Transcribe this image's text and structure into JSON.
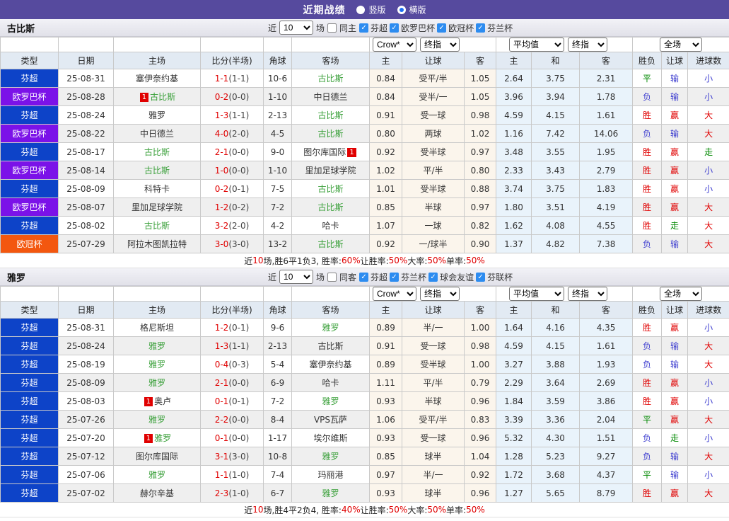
{
  "titlebar": {
    "title": "近期战绩",
    "vertical_label": "竖版",
    "horizontal_label": "横版"
  },
  "filters": {
    "near_label": "近",
    "count_value": "10",
    "matches_label": "场"
  },
  "dropdowns": {
    "company": "Crow*",
    "final": "终指",
    "average": "平均值",
    "final2": "终指",
    "scope": "全场"
  },
  "columns": [
    "类型",
    "日期",
    "主场",
    "比分(半场)",
    "角球",
    "客场",
    "主",
    "让球",
    "客",
    "主",
    "和",
    "客",
    "胜负",
    "让球",
    "进球数"
  ],
  "colors": {
    "topbar_purple": "#564a9e",
    "league_bg": {
      "芬超": "#0d43c8",
      "欧罗巴杯": "#7b12e8",
      "欧冠杯": "#f3570f"
    },
    "result_text": {
      "胜": "#e00000",
      "负": "#4040d0",
      "平": "#008800",
      "赢": "#e00000",
      "输": "#4040d0",
      "走": "#008800",
      "大": "#e00000",
      "小": "#4040d0"
    },
    "team_highlight": "#3aa03a",
    "score_red": "#e00000",
    "badge_bg": "#e00000",
    "checkbox_blue": "#2d8cf0",
    "beige_col": "#fbf5ec",
    "blue_col": "#e9f3fb",
    "stripe": "#efefef"
  },
  "sections": [
    {
      "team": "古比斯",
      "same_label": "同主",
      "league_filters": [
        "芬超",
        "欧罗巴杯",
        "欧冠杯",
        "芬兰杯"
      ],
      "rows": [
        {
          "league": "芬超",
          "date": "25-08-31",
          "home": {
            "name": "塞伊奈约基"
          },
          "score": "1-1",
          "half": "(1-1)",
          "corners": "10-6",
          "away": {
            "name": "古比斯",
            "hl": true
          },
          "odds": [
            "0.84",
            "受平/半",
            "1.05"
          ],
          "avg": [
            "2.64",
            "3.75",
            "2.31"
          ],
          "res": [
            "平",
            "输",
            "小"
          ]
        },
        {
          "league": "欧罗巴杯",
          "date": "25-08-28",
          "home": {
            "name": "古比斯",
            "hl": true,
            "badge": "1",
            "badge_pos": "before"
          },
          "score": "0-2",
          "half": "(0-0)",
          "corners": "1-10",
          "away": {
            "name": "中日德兰"
          },
          "odds": [
            "0.84",
            "受半/一",
            "1.05"
          ],
          "avg": [
            "3.96",
            "3.94",
            "1.78"
          ],
          "res": [
            "负",
            "输",
            "小"
          ]
        },
        {
          "league": "芬超",
          "date": "25-08-24",
          "home": {
            "name": "雅罗"
          },
          "score": "1-3",
          "half": "(1-1)",
          "corners": "2-13",
          "away": {
            "name": "古比斯",
            "hl": true
          },
          "odds": [
            "0.91",
            "受一球",
            "0.98"
          ],
          "avg": [
            "4.59",
            "4.15",
            "1.61"
          ],
          "res": [
            "胜",
            "赢",
            "大"
          ]
        },
        {
          "league": "欧罗巴杯",
          "date": "25-08-22",
          "home": {
            "name": "中日德兰"
          },
          "score": "4-0",
          "half": "(2-0)",
          "corners": "4-5",
          "away": {
            "name": "古比斯",
            "hl": true
          },
          "odds": [
            "0.80",
            "两球",
            "1.02"
          ],
          "avg": [
            "1.16",
            "7.42",
            "14.06"
          ],
          "res": [
            "负",
            "输",
            "大"
          ]
        },
        {
          "league": "芬超",
          "date": "25-08-17",
          "home": {
            "name": "古比斯",
            "hl": true
          },
          "score": "2-1",
          "half": "(0-0)",
          "corners": "9-0",
          "away": {
            "name": "图尔库国际",
            "badge": "1",
            "badge_pos": "after"
          },
          "odds": [
            "0.92",
            "受半球",
            "0.97"
          ],
          "avg": [
            "3.48",
            "3.55",
            "1.95"
          ],
          "res": [
            "胜",
            "赢",
            "走"
          ]
        },
        {
          "league": "欧罗巴杯",
          "date": "25-08-14",
          "home": {
            "name": "古比斯",
            "hl": true
          },
          "score": "1-0",
          "half": "(0-0)",
          "corners": "1-10",
          "away": {
            "name": "里加足球学院"
          },
          "odds": [
            "1.02",
            "平/半",
            "0.80"
          ],
          "avg": [
            "2.33",
            "3.43",
            "2.79"
          ],
          "res": [
            "胜",
            "赢",
            "小"
          ]
        },
        {
          "league": "芬超",
          "date": "25-08-09",
          "home": {
            "name": "科特卡"
          },
          "score": "0-2",
          "half": "(0-1)",
          "corners": "7-5",
          "away": {
            "name": "古比斯",
            "hl": true
          },
          "odds": [
            "1.01",
            "受半球",
            "0.88"
          ],
          "avg": [
            "3.74",
            "3.75",
            "1.83"
          ],
          "res": [
            "胜",
            "赢",
            "小"
          ]
        },
        {
          "league": "欧罗巴杯",
          "date": "25-08-07",
          "home": {
            "name": "里加足球学院"
          },
          "score": "1-2",
          "half": "(0-2)",
          "corners": "7-2",
          "away": {
            "name": "古比斯",
            "hl": true
          },
          "odds": [
            "0.85",
            "半球",
            "0.97"
          ],
          "avg": [
            "1.80",
            "3.51",
            "4.19"
          ],
          "res": [
            "胜",
            "赢",
            "大"
          ]
        },
        {
          "league": "芬超",
          "date": "25-08-02",
          "home": {
            "name": "古比斯",
            "hl": true
          },
          "score": "3-2",
          "half": "(2-0)",
          "corners": "4-2",
          "away": {
            "name": "哈卡"
          },
          "odds": [
            "1.07",
            "一球",
            "0.82"
          ],
          "avg": [
            "1.62",
            "4.08",
            "4.55"
          ],
          "res": [
            "胜",
            "走",
            "大"
          ]
        },
        {
          "league": "欧冠杯",
          "date": "25-07-29",
          "home": {
            "name": "阿拉木图凯拉特"
          },
          "score": "3-0",
          "half": "(3-0)",
          "corners": "13-2",
          "away": {
            "name": "古比斯",
            "hl": true
          },
          "odds": [
            "0.92",
            "一/球半",
            "0.90"
          ],
          "avg": [
            "1.37",
            "4.82",
            "7.38"
          ],
          "res": [
            "负",
            "输",
            "大"
          ]
        }
      ],
      "summary": [
        {
          "t": "近"
        },
        {
          "t": "10",
          "red": true
        },
        {
          "t": "场,胜6平1负3, 胜率:"
        },
        {
          "t": "60%",
          "red": true
        },
        {
          "t": " 让胜率:"
        },
        {
          "t": "50%",
          "red": true
        },
        {
          "t": " 大率:"
        },
        {
          "t": "50%",
          "red": true
        },
        {
          "t": " 单率:"
        },
        {
          "t": "50%",
          "red": true
        }
      ]
    },
    {
      "team": "雅罗",
      "same_label": "同客",
      "league_filters": [
        "芬超",
        "芬兰杯",
        "球会友谊",
        "芬联杯"
      ],
      "rows": [
        {
          "league": "芬超",
          "date": "25-08-31",
          "home": {
            "name": "格尼斯坦"
          },
          "score": "1-2",
          "half": "(0-1)",
          "corners": "9-6",
          "away": {
            "name": "雅罗",
            "hl": true
          },
          "odds": [
            "0.89",
            "半/一",
            "1.00"
          ],
          "avg": [
            "1.64",
            "4.16",
            "4.35"
          ],
          "res": [
            "胜",
            "赢",
            "小"
          ]
        },
        {
          "league": "芬超",
          "date": "25-08-24",
          "home": {
            "name": "雅罗",
            "hl": true
          },
          "score": "1-3",
          "half": "(1-1)",
          "corners": "2-13",
          "away": {
            "name": "古比斯"
          },
          "odds": [
            "0.91",
            "受一球",
            "0.98"
          ],
          "avg": [
            "4.59",
            "4.15",
            "1.61"
          ],
          "res": [
            "负",
            "输",
            "大"
          ]
        },
        {
          "league": "芬超",
          "date": "25-08-19",
          "home": {
            "name": "雅罗",
            "hl": true
          },
          "score": "0-4",
          "half": "(0-3)",
          "corners": "5-4",
          "away": {
            "name": "塞伊奈约基"
          },
          "odds": [
            "0.89",
            "受半球",
            "1.00"
          ],
          "avg": [
            "3.27",
            "3.88",
            "1.93"
          ],
          "res": [
            "负",
            "输",
            "大"
          ]
        },
        {
          "league": "芬超",
          "date": "25-08-09",
          "home": {
            "name": "雅罗",
            "hl": true
          },
          "score": "2-1",
          "half": "(0-0)",
          "corners": "6-9",
          "away": {
            "name": "哈卡"
          },
          "odds": [
            "1.11",
            "平/半",
            "0.79"
          ],
          "avg": [
            "2.29",
            "3.64",
            "2.69"
          ],
          "res": [
            "胜",
            "赢",
            "小"
          ]
        },
        {
          "league": "芬超",
          "date": "25-08-03",
          "home": {
            "name": "奥卢",
            "badge": "1",
            "badge_pos": "before"
          },
          "score": "0-1",
          "half": "(0-1)",
          "corners": "7-2",
          "away": {
            "name": "雅罗",
            "hl": true
          },
          "odds": [
            "0.93",
            "半球",
            "0.96"
          ],
          "avg": [
            "1.84",
            "3.59",
            "3.86"
          ],
          "res": [
            "胜",
            "赢",
            "小"
          ]
        },
        {
          "league": "芬超",
          "date": "25-07-26",
          "home": {
            "name": "雅罗",
            "hl": true
          },
          "score": "2-2",
          "half": "(0-0)",
          "corners": "8-4",
          "away": {
            "name": "VPS瓦萨"
          },
          "odds": [
            "1.06",
            "受平/半",
            "0.83"
          ],
          "avg": [
            "3.39",
            "3.36",
            "2.04"
          ],
          "res": [
            "平",
            "赢",
            "大"
          ]
        },
        {
          "league": "芬超",
          "date": "25-07-20",
          "home": {
            "name": "雅罗",
            "hl": true,
            "badge": "1",
            "badge_pos": "before"
          },
          "score": "0-1",
          "half": "(0-0)",
          "corners": "1-17",
          "away": {
            "name": "埃尔维斯"
          },
          "odds": [
            "0.93",
            "受一球",
            "0.96"
          ],
          "avg": [
            "5.32",
            "4.30",
            "1.51"
          ],
          "res": [
            "负",
            "走",
            "小"
          ]
        },
        {
          "league": "芬超",
          "date": "25-07-12",
          "home": {
            "name": "图尔库国际"
          },
          "score": "3-1",
          "half": "(3-0)",
          "corners": "10-8",
          "away": {
            "name": "雅罗",
            "hl": true
          },
          "odds": [
            "0.85",
            "球半",
            "1.04"
          ],
          "avg": [
            "1.28",
            "5.23",
            "9.27"
          ],
          "res": [
            "负",
            "输",
            "大"
          ]
        },
        {
          "league": "芬超",
          "date": "25-07-06",
          "home": {
            "name": "雅罗",
            "hl": true
          },
          "score": "1-1",
          "half": "(1-0)",
          "corners": "7-4",
          "away": {
            "name": "玛丽港"
          },
          "odds": [
            "0.97",
            "半/一",
            "0.92"
          ],
          "avg": [
            "1.72",
            "3.68",
            "4.37"
          ],
          "res": [
            "平",
            "输",
            "小"
          ]
        },
        {
          "league": "芬超",
          "date": "25-07-02",
          "home": {
            "name": "赫尔辛基"
          },
          "score": "2-3",
          "half": "(1-0)",
          "corners": "6-7",
          "away": {
            "name": "雅罗",
            "hl": true
          },
          "odds": [
            "0.93",
            "球半",
            "0.96"
          ],
          "avg": [
            "1.27",
            "5.65",
            "8.79"
          ],
          "res": [
            "胜",
            "赢",
            "大"
          ]
        }
      ],
      "summary": [
        {
          "t": "近"
        },
        {
          "t": "10",
          "red": true
        },
        {
          "t": "场,胜4平2负4, 胜率:"
        },
        {
          "t": "40%",
          "red": true
        },
        {
          "t": " 让胜率:"
        },
        {
          "t": "50%",
          "red": true
        },
        {
          "t": " 大率:"
        },
        {
          "t": "50%",
          "red": true
        },
        {
          "t": " 单率:"
        },
        {
          "t": "50%",
          "red": true
        }
      ]
    }
  ]
}
